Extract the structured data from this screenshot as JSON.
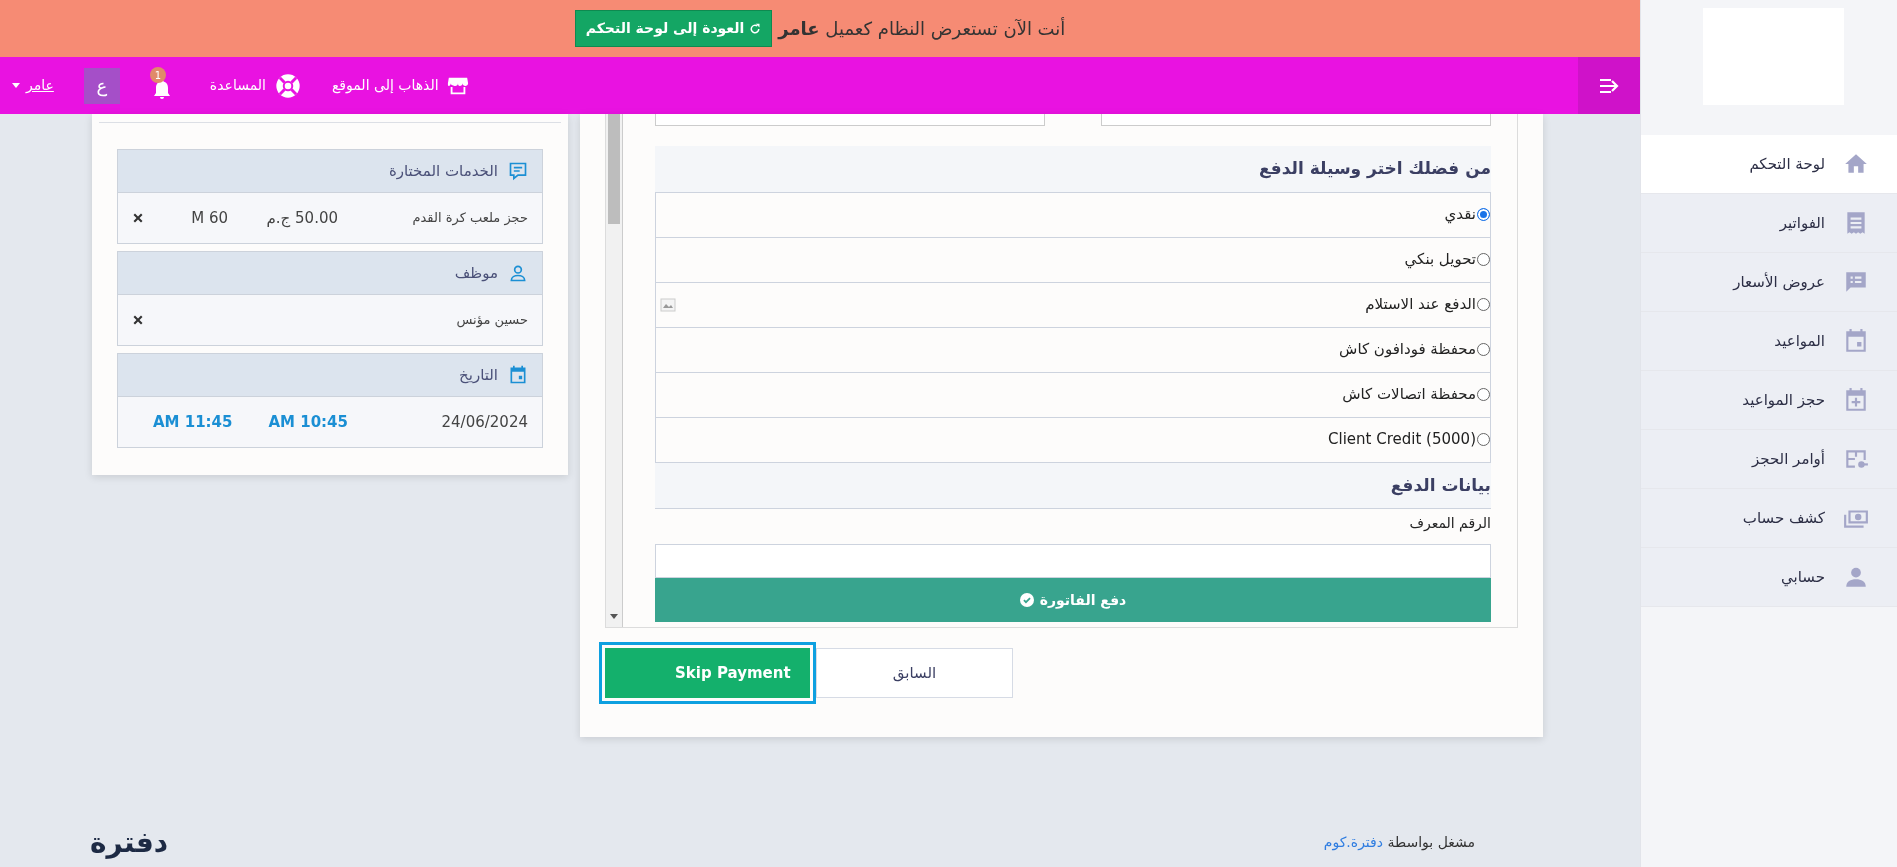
{
  "banner": {
    "message": "أنت الآن تستعرض النظام كعميل **عامر**",
    "button": "العودة إلى لوحة التحكم"
  },
  "navbar": {
    "links": [
      {
        "label": "الذهاب إلى الموقع",
        "kind": "store"
      },
      {
        "label": "المساعدة",
        "kind": "help"
      }
    ],
    "notifications": "1",
    "user": {
      "initial": "ع",
      "name": "عامر"
    }
  },
  "payment": {
    "methods_title": "من فضلك اختر وسيلة الدفع",
    "methods": [
      {
        "label": "نقدي",
        "selected": true
      },
      {
        "label": "تحويل بنكي",
        "selected": false
      },
      {
        "label": "الدفع عند الاستلام",
        "selected": false,
        "image": true
      },
      {
        "label": "محفظة فودافون كاش",
        "selected": false
      },
      {
        "label": "محفظة اتصالات كاش",
        "selected": false
      },
      {
        "label": "Client Credit (5000)",
        "selected": false
      }
    ],
    "details_title": "بيانات الدفع",
    "field_label": "الرقم المعرف",
    "submit": "دفع الفاتورة"
  },
  "actions": [
    {
      "label": "السابق",
      "kind": "back",
      "focused": false
    },
    {
      "label": "Skip Payment",
      "kind": "skip",
      "focused": true
    }
  ],
  "summary": {
    "services": {
      "title": "الخدمات المختارة",
      "items": [
        {
          "name": "حجز ملعب كرة القدم",
          "price": "50.00 ج.م",
          "duration": "M 60"
        }
      ]
    },
    "staff": {
      "title": "موظف",
      "items": [
        {
          "name": "حسين مؤنس"
        }
      ]
    },
    "date": {
      "title": "التاريخ",
      "date": "24/06/2024",
      "start": "AM 10:45",
      "end": "AM 11:45"
    }
  },
  "sidebar": {
    "items": [
      {
        "label": "لوحة التحكم",
        "kind": "home",
        "selected": true
      },
      {
        "label": "الفواتير",
        "kind": "invoice",
        "selected": false
      },
      {
        "label": "عروض الأسعار",
        "kind": "quote",
        "selected": false
      },
      {
        "label": "المواعيد",
        "kind": "calendar",
        "selected": false
      },
      {
        "label": "حجز المواعيد",
        "kind": "calendar-add",
        "selected": false
      },
      {
        "label": "أوامر الحجز",
        "kind": "orders",
        "selected": false
      },
      {
        "label": "كشف حساب",
        "kind": "money",
        "selected": false
      },
      {
        "label": "حسابي",
        "kind": "user",
        "selected": false
      }
    ]
  },
  "footer": {
    "powered_by": "مشغل بواسطة",
    "link": "دفترة.كوم",
    "logo": "دفترة"
  }
}
